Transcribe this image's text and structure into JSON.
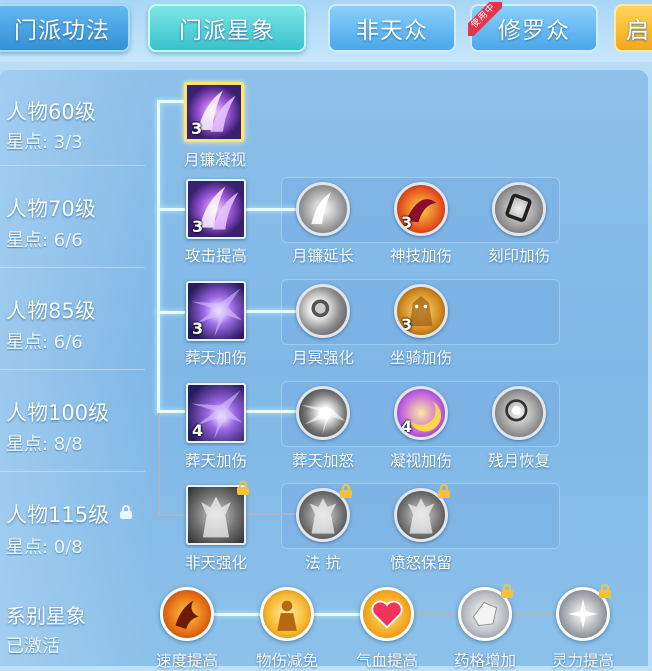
{
  "tabs": [
    {
      "label": "门派功法",
      "style": "blue"
    },
    {
      "label": "门派星象",
      "style": "cyan",
      "active": true
    },
    {
      "label": "非天众",
      "style": "light"
    },
    {
      "label": "修罗众",
      "style": "light",
      "badge": "使用中"
    },
    {
      "label": "启",
      "style": "gold"
    }
  ],
  "rows": [
    {
      "title": "人物60级",
      "stars": "星点: 3/3",
      "locked": false
    },
    {
      "title": "人物70级",
      "stars": "星点: 6/6",
      "locked": false
    },
    {
      "title": "人物85级",
      "stars": "星点: 6/6",
      "locked": false
    },
    {
      "title": "人物100级",
      "stars": "星点: 8/8",
      "locked": false
    },
    {
      "title": "人物115级",
      "stars": "星点: 0/8",
      "locked": true
    }
  ],
  "nodes": {
    "r60": {
      "main": {
        "label": "月镰凝视",
        "level": "3",
        "icon": "crescent-blade-icon"
      }
    },
    "r70": {
      "main": {
        "label": "攻击提高",
        "level": "3",
        "icon": "crescent-blade-icon"
      },
      "subs": [
        {
          "label": "月镰延长",
          "level": "",
          "icon": "blade-gray-icon"
        },
        {
          "label": "神技加伤",
          "level": "3",
          "icon": "demon-claw-icon"
        },
        {
          "label": "刻印加伤",
          "level": "",
          "icon": "rune-mark-icon"
        }
      ]
    },
    "r85": {
      "main": {
        "label": "葬天加伤",
        "level": "3",
        "icon": "void-burst-icon"
      },
      "subs": [
        {
          "label": "月冥强化",
          "level": "",
          "icon": "dark-moon-icon"
        },
        {
          "label": "坐骑加伤",
          "level": "3",
          "icon": "golden-mount-icon"
        }
      ]
    },
    "r100": {
      "main": {
        "label": "葬天加伤",
        "level": "4",
        "icon": "void-burst-icon"
      },
      "subs": [
        {
          "label": "葬天加怒",
          "level": "",
          "icon": "rage-burst-icon"
        },
        {
          "label": "凝视加伤",
          "level": "4",
          "icon": "moon-gaze-icon"
        },
        {
          "label": "残月恢复",
          "level": "",
          "icon": "wane-moon-icon"
        }
      ]
    },
    "r115": {
      "main": {
        "label": "非天强化",
        "level": "",
        "icon": "asura-statue-icon",
        "locked": true
      },
      "subs": [
        {
          "label": "法 抗",
          "level": "",
          "icon": "asura-statue-icon",
          "locked": true
        },
        {
          "label": "愤怒保留",
          "level": "",
          "icon": "asura-statue-icon",
          "locked": true
        }
      ]
    }
  },
  "system": {
    "title": "系别星象",
    "status": "已激活",
    "items": [
      {
        "label": "速度提高",
        "icon": "speed-flame-icon",
        "locked": false
      },
      {
        "label": "物伤减免",
        "icon": "guardian-figure-icon",
        "locked": false
      },
      {
        "label": "气血提高",
        "icon": "heart-icon",
        "locked": false
      },
      {
        "label": "药格增加",
        "icon": "gem-icon",
        "locked": true
      },
      {
        "label": "灵力提高",
        "icon": "spirit-star-icon",
        "locked": true
      }
    ]
  }
}
